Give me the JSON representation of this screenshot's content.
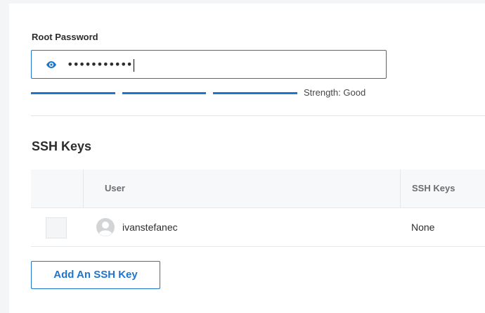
{
  "root_password": {
    "label": "Root Password",
    "masked_value": "•••••••••••",
    "toggle_icon": "eye-icon",
    "strength_text": "Strength: Good",
    "strength_segments_filled": 3,
    "strength_segments_total": 3
  },
  "ssh_keys": {
    "title": "SSH Keys",
    "columns": [
      "User",
      "SSH Keys"
    ],
    "rows": [
      {
        "user": "ivanstefanec",
        "keys": "None",
        "avatar_icon": "user-avatar-icon"
      }
    ],
    "add_button": "Add An SSH Key"
  },
  "colors": {
    "accent": "#1f75cb",
    "text": "#2b2d2f",
    "muted": "#6c6e71",
    "header_bg": "#f7f8f9"
  }
}
